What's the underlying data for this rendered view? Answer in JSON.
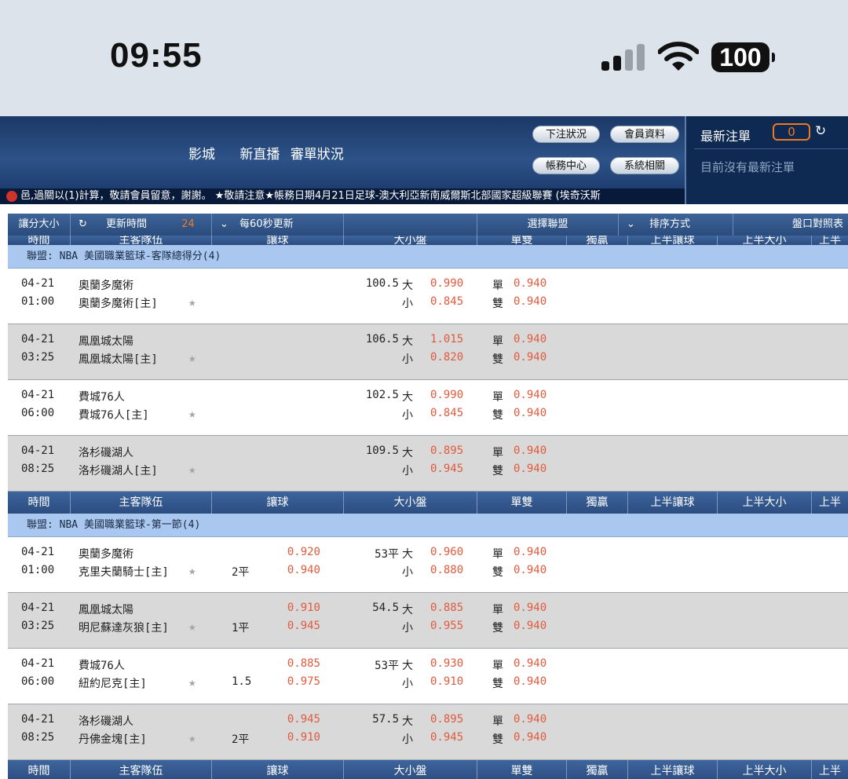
{
  "status_bar": {
    "time": "09:55",
    "battery": "100"
  },
  "header": {
    "nav": [
      "影城",
      "新直播",
      "審單狀況"
    ],
    "buttons": [
      "下注狀況",
      "會員資料",
      "帳務中心",
      "系統相關"
    ],
    "latest_bets": {
      "title": "最新注單",
      "count": "0",
      "empty_text": "目前沒有最新注單"
    }
  },
  "ticker": "​⾢,過關以(1)計算，敬請會員留意，謝謝。 ★敬請注意★帳務日期4月21日足球-澳大利亞新南威爾斯北部國家超級聯賽 (埃奇沃斯",
  "toolbar": {
    "odds_size": "讓分大小",
    "update_time": "更新時間",
    "countdown": "24",
    "auto_refresh": "每60秒更新",
    "select_league": "選擇聯盟",
    "sort": "排序方式",
    "odds_table": "盤口對照表"
  },
  "columns": [
    "時間",
    "主客隊伍",
    "讓球",
    "大小盤",
    "單雙",
    "獨贏",
    "上半讓球",
    "上半大小",
    "上半"
  ],
  "labels": {
    "big": "大",
    "small": "小",
    "odd": "單",
    "even": "雙"
  },
  "leagues": [
    {
      "title": "聯盟: NBA 美國職業籃球-客隊總得分(4)",
      "matches": [
        {
          "date": "04-21",
          "time": "01:00",
          "team1": "奧蘭多魔術",
          "team2": "奧蘭多魔術[主]",
          "hdp": "",
          "hdp_odds1": "",
          "hdp_odds2": "",
          "ou_line": "100.5",
          "over": "0.990",
          "under": "0.845",
          "odd": "0.940",
          "even": "0.940"
        },
        {
          "date": "04-21",
          "time": "03:25",
          "team1": "鳳凰城太陽",
          "team2": "鳳凰城太陽[主]",
          "hdp": "",
          "hdp_odds1": "",
          "hdp_odds2": "",
          "ou_line": "106.5",
          "over": "1.015",
          "under": "0.820",
          "odd": "0.940",
          "even": "0.940"
        },
        {
          "date": "04-21",
          "time": "06:00",
          "team1": "費城76人",
          "team2": "費城76人[主]",
          "hdp": "",
          "hdp_odds1": "",
          "hdp_odds2": "",
          "ou_line": "102.5",
          "over": "0.990",
          "under": "0.845",
          "odd": "0.940",
          "even": "0.940"
        },
        {
          "date": "04-21",
          "time": "08:25",
          "team1": "洛杉磯湖人",
          "team2": "洛杉磯湖人[主]",
          "hdp": "",
          "hdp_odds1": "",
          "hdp_odds2": "",
          "ou_line": "109.5",
          "over": "0.895",
          "under": "0.945",
          "odd": "0.940",
          "even": "0.940"
        }
      ]
    },
    {
      "title": "聯盟: NBA 美國職業籃球-第一節(4)",
      "matches": [
        {
          "date": "04-21",
          "time": "01:00",
          "team1": "奧蘭多魔術",
          "team2": "克里夫蘭騎士[主]",
          "hdp": "2平",
          "hdp_odds1": "0.920",
          "hdp_odds2": "0.940",
          "ou_line": "53平",
          "over": "0.960",
          "under": "0.880",
          "odd": "0.940",
          "even": "0.940"
        },
        {
          "date": "04-21",
          "time": "03:25",
          "team1": "鳳凰城太陽",
          "team2": "明尼蘇達灰狼[主]",
          "hdp": "1平",
          "hdp_odds1": "0.910",
          "hdp_odds2": "0.945",
          "ou_line": "54.5",
          "over": "0.885",
          "under": "0.955",
          "odd": "0.940",
          "even": "0.940"
        },
        {
          "date": "04-21",
          "time": "06:00",
          "team1": "費城76人",
          "team2": "紐約尼克[主]",
          "hdp": "1.5",
          "hdp_odds1": "0.885",
          "hdp_odds2": "0.975",
          "ou_line": "53平",
          "over": "0.930",
          "under": "0.910",
          "odd": "0.940",
          "even": "0.940"
        },
        {
          "date": "04-21",
          "time": "08:25",
          "team1": "洛杉磯湖人",
          "team2": "丹佛金塊[主]",
          "hdp": "2平",
          "hdp_odds1": "0.945",
          "hdp_odds2": "0.910",
          "ou_line": "57.5",
          "over": "0.895",
          "under": "0.945",
          "odd": "0.940",
          "even": "0.940"
        }
      ]
    }
  ]
}
